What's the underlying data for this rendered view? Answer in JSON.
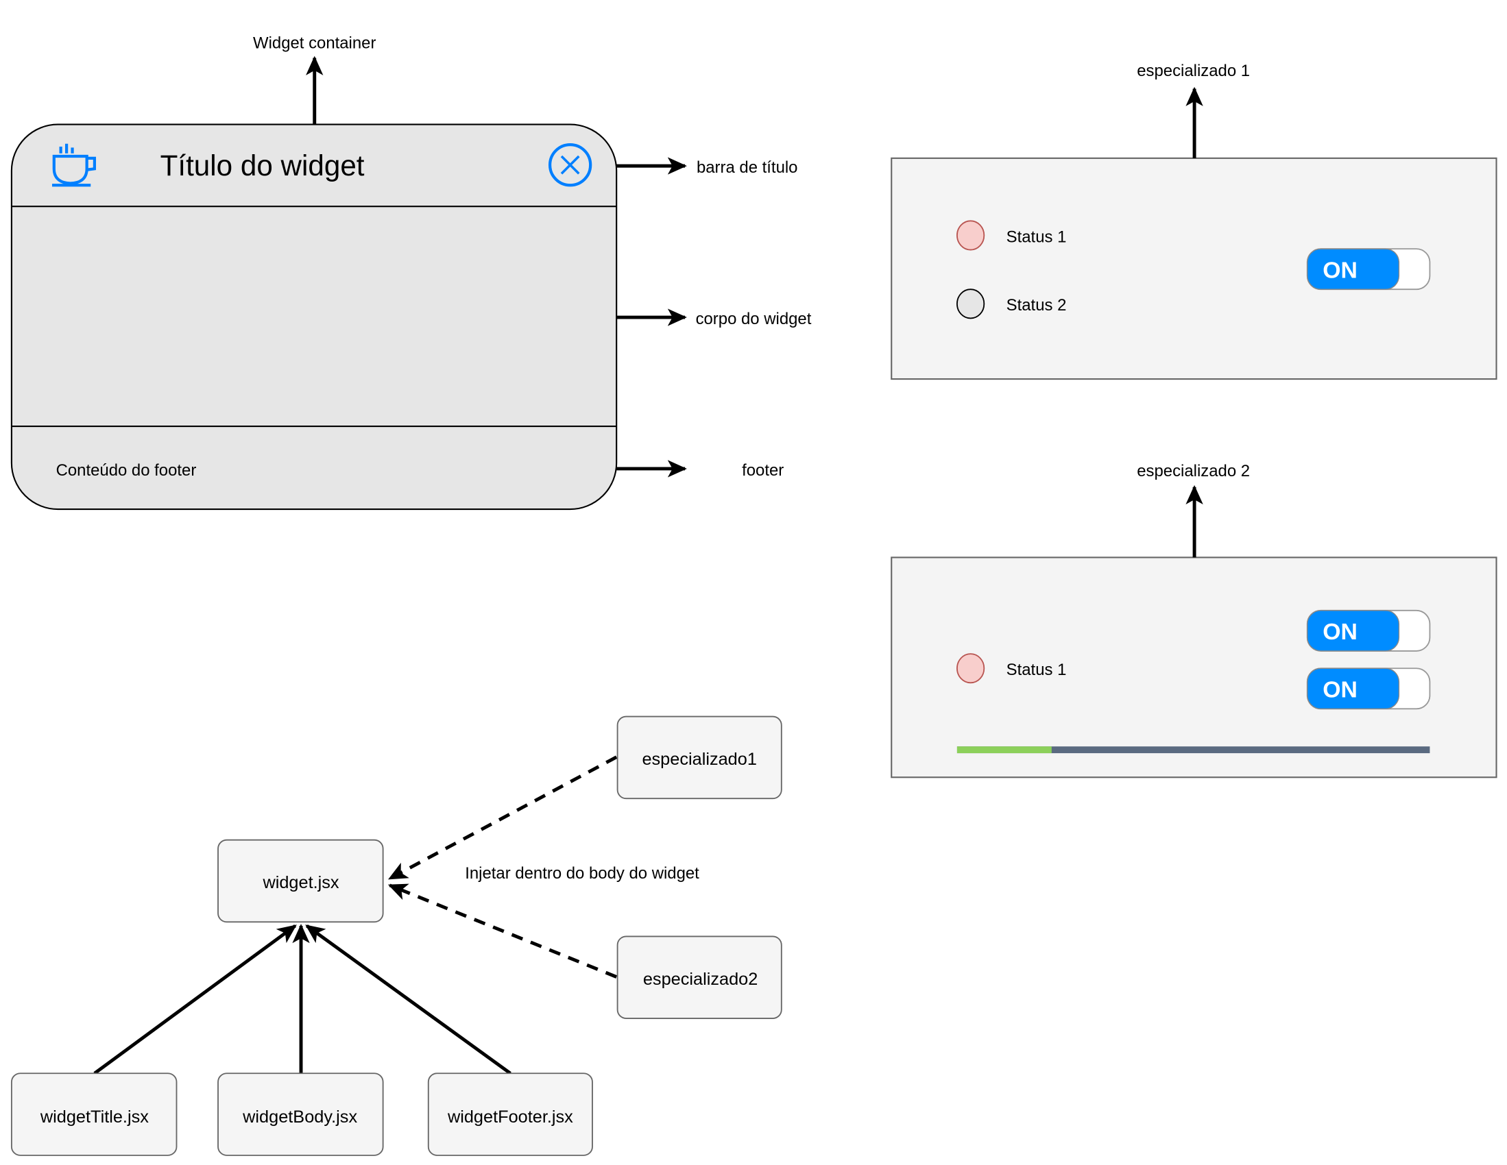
{
  "widget_mockup": {
    "title": "Título do widget",
    "footer_text": "Conteúdo do footer",
    "icons": {
      "app": "coffee-cup-icon",
      "close": "close-circle-icon"
    },
    "colors": {
      "fill": "#e6e6e6",
      "stroke": "#000000",
      "icon": "#007fff"
    }
  },
  "annotations": {
    "container": "Widget container",
    "title_bar": "barra de título",
    "body": "corpo do widget",
    "footer": "footer"
  },
  "specialized_1": {
    "label": "especializado 1",
    "statuses": [
      {
        "label": "Status 1",
        "color": "#f8cecc",
        "stroke": "#b85450"
      },
      {
        "label": "Status 2",
        "color": "#e6e6e6",
        "stroke": "#000000"
      }
    ],
    "toggles": [
      {
        "label": "ON",
        "state": "on"
      }
    ]
  },
  "specialized_2": {
    "label": "especializado 2",
    "statuses": [
      {
        "label": "Status 1",
        "color": "#f8cecc",
        "stroke": "#b85450"
      }
    ],
    "toggles": [
      {
        "label": "ON",
        "state": "on"
      },
      {
        "label": "ON",
        "state": "on"
      }
    ],
    "progress": {
      "value": 0.2,
      "fill_color": "#8cd05a",
      "track_color": "#5a6a80"
    }
  },
  "component_tree": {
    "root": "widget.jsx",
    "children": [
      "widgetTitle.jsx",
      "widgetBody.jsx",
      "widgetFooter.jsx"
    ],
    "injected": [
      "especializado1",
      "especializado2"
    ],
    "injection_label": "Injetar dentro do body do widget"
  },
  "colors": {
    "toggle_on": "#008cff",
    "panel": "#f4f4f4",
    "node": "#f5f5f5"
  }
}
